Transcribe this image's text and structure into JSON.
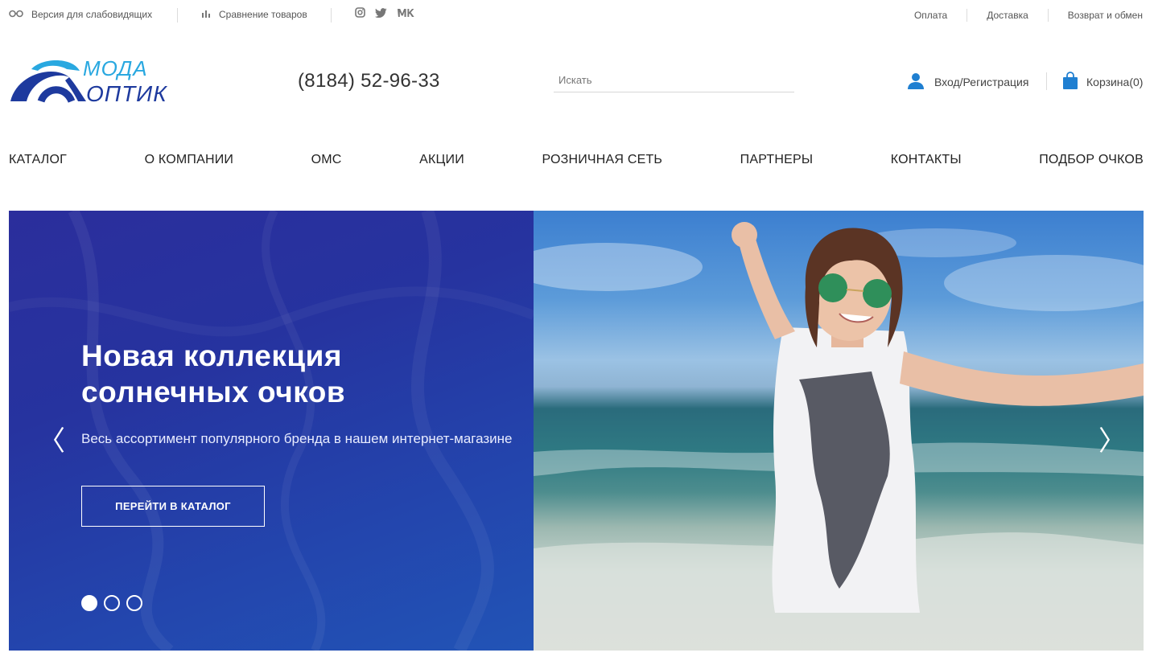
{
  "topbar": {
    "low_vision_label": "Версия для слабовидящих",
    "compare_label": "Сравнение товаров",
    "social": [
      "instagram-icon",
      "twitter-icon",
      "vk-icon"
    ],
    "social_glyphs": [
      "◎",
      "🐦",
      "VK"
    ],
    "links": [
      {
        "label": "Оплата"
      },
      {
        "label": "Доставка"
      },
      {
        "label": "Возврат и обмен"
      }
    ]
  },
  "header": {
    "logo_top": "МОДА",
    "logo_bottom": "ОПТИК",
    "phone": "(8184) 52-96-33",
    "search_placeholder": "Искать",
    "auth_label": "Вход/Регистрация",
    "cart_label": "Корзина(0)"
  },
  "nav": {
    "items": [
      {
        "label": "КАТАЛОГ"
      },
      {
        "label": "О КОМПАНИИ"
      },
      {
        "label": "ОМС"
      },
      {
        "label": "АКЦИИ"
      },
      {
        "label": "РОЗНИЧНАЯ СЕТЬ"
      },
      {
        "label": "ПАРТНЕРЫ"
      },
      {
        "label": "КОНТАКТЫ"
      },
      {
        "label": "ПОДБОР ОЧКОВ"
      }
    ]
  },
  "slider": {
    "title": "Новая коллекция солнечных очков",
    "subtitle": "Весь ассортимент популярного бренда в нашем интернет-магазине",
    "button_label": "ПЕРЕЙТИ В КАТАЛОГ",
    "prev_glyph": "〈",
    "next_glyph": "〉",
    "slide_count": 3,
    "active_slide": 1
  },
  "colors": {
    "brand_blue": "#1e3a9e",
    "brand_cyan": "#29a8e0",
    "slide_bg": "#2a3ba6",
    "icon_blue": "#1f7fd1"
  }
}
